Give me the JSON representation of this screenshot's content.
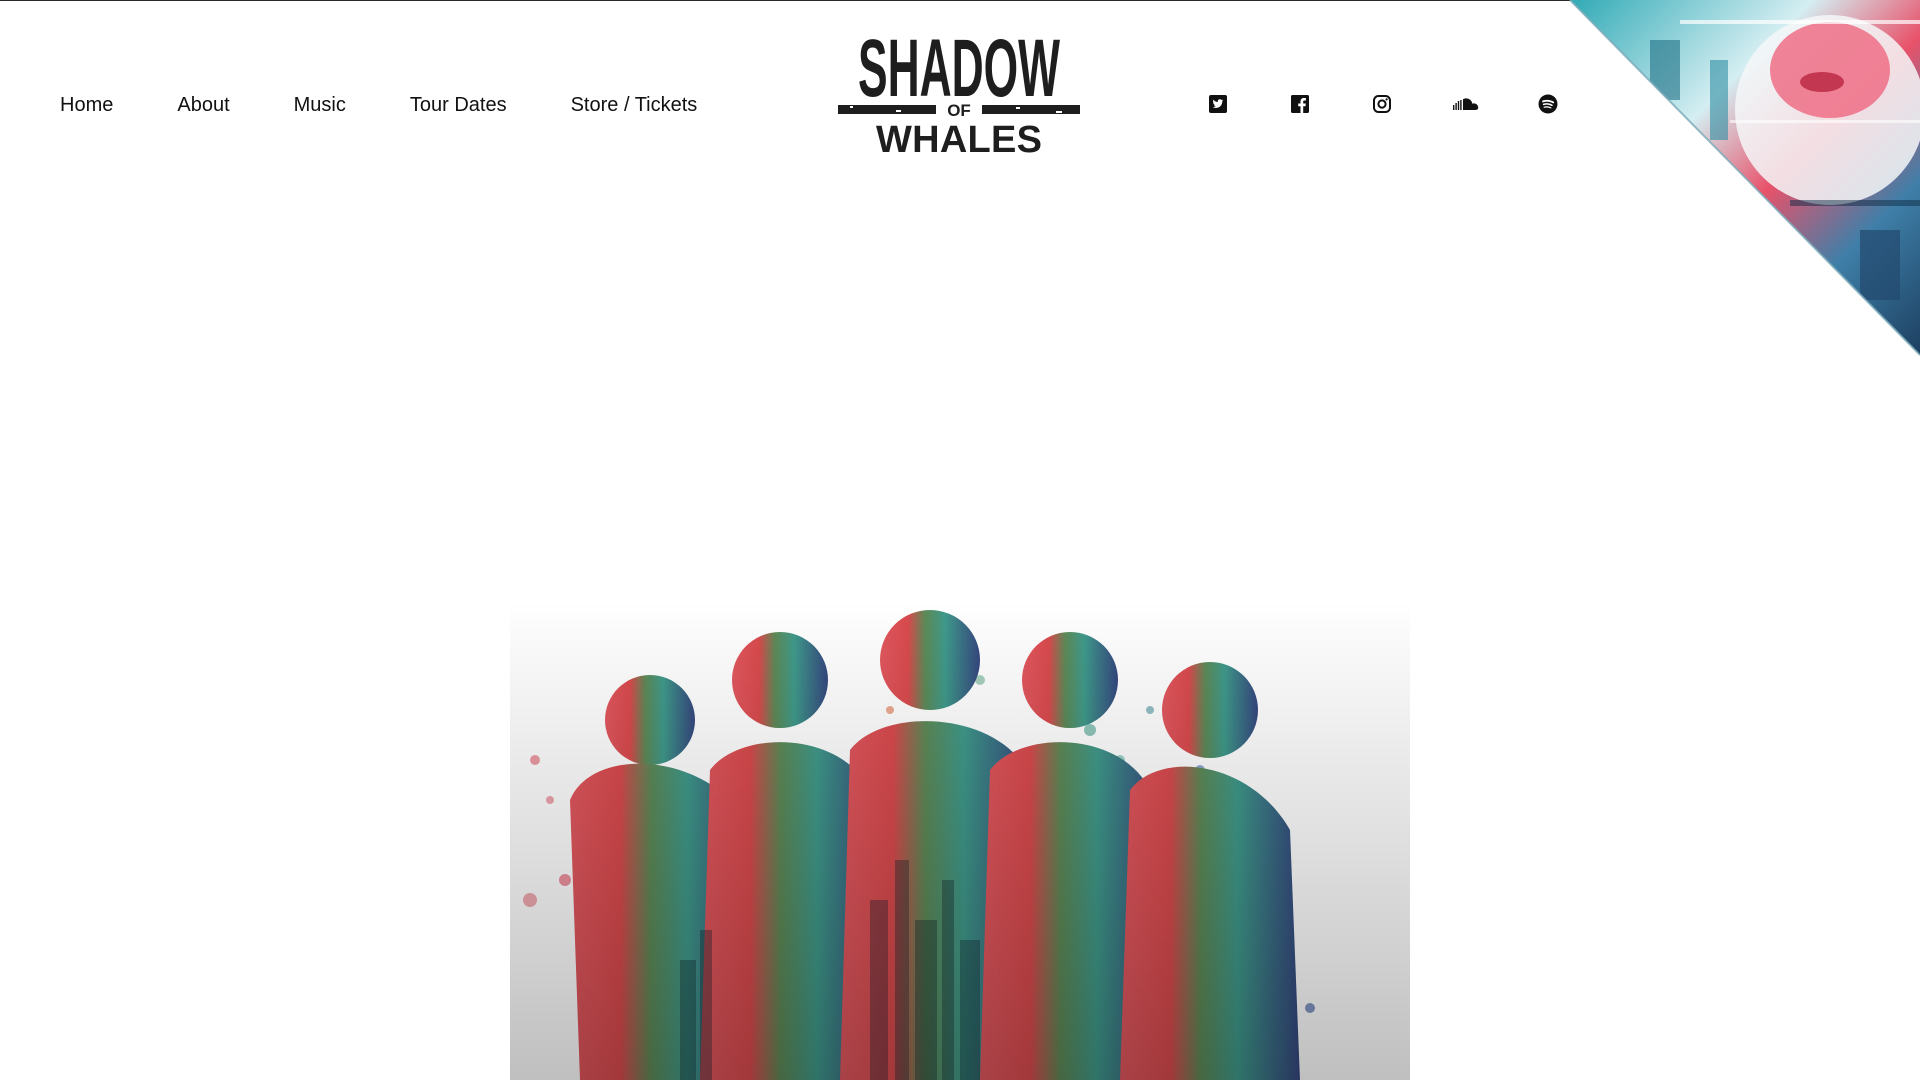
{
  "site": {
    "name": "Shadow of Whales"
  },
  "logo": {
    "line1": "SHADOW",
    "line2": "OF",
    "line3": "WHALES"
  },
  "nav": {
    "items": [
      {
        "label": "Home"
      },
      {
        "label": "About"
      },
      {
        "label": "Music"
      },
      {
        "label": "Tour Dates"
      },
      {
        "label": "Store / Tickets"
      }
    ]
  },
  "social": {
    "icons": [
      "twitter-icon",
      "facebook-icon",
      "instagram-icon",
      "soundcloud-icon",
      "spotify-icon"
    ]
  },
  "colors": {
    "text": "#111111",
    "background": "#ffffff",
    "logo": "#1e1e1e",
    "accent_red": "#d9414b",
    "accent_teal": "#3f9f8e",
    "accent_blue": "#3a4f8f"
  }
}
